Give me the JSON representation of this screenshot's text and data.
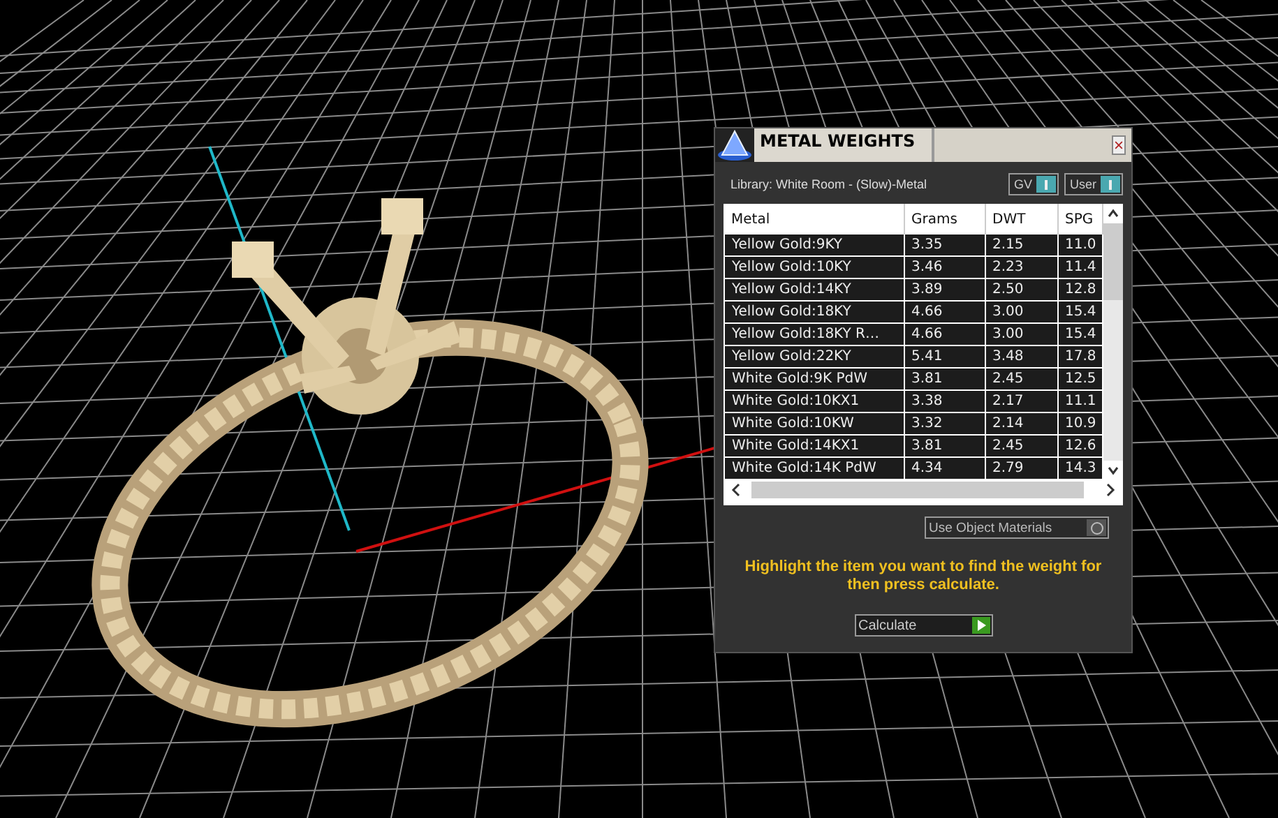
{
  "dialog": {
    "title": "METAL WEIGHTS",
    "library": "Library: White Room - (Slow)-Metal",
    "toggles": [
      {
        "label": "GV",
        "on": true
      },
      {
        "label": "User",
        "on": true
      }
    ],
    "table": {
      "columns": [
        "Metal",
        "Grams",
        "DWT",
        "SPG"
      ],
      "rows": [
        [
          "Yellow Gold:9KY",
          "3.35",
          "2.15",
          "11.0"
        ],
        [
          "Yellow Gold:10KY",
          "3.46",
          "2.23",
          "11.4"
        ],
        [
          "Yellow Gold:14KY",
          "3.89",
          "2.50",
          "12.8"
        ],
        [
          "Yellow Gold:18KY",
          "4.66",
          "3.00",
          "15.4"
        ],
        [
          "Yellow Gold:18KY R…",
          "4.66",
          "3.00",
          "15.4"
        ],
        [
          "Yellow Gold:22KY",
          "5.41",
          "3.48",
          "17.8"
        ],
        [
          "White Gold:9K PdW",
          "3.81",
          "2.45",
          "12.5"
        ],
        [
          "White Gold:10KX1",
          "3.38",
          "2.17",
          "11.1"
        ],
        [
          "White Gold:10KW",
          "3.32",
          "2.14",
          "10.9"
        ],
        [
          "White Gold:14KX1",
          "3.81",
          "2.45",
          "12.6"
        ],
        [
          "White Gold:14K PdW",
          "4.34",
          "2.79",
          "14.3"
        ]
      ]
    },
    "use_object_materials": {
      "label": "Use Object Materials",
      "checked": false
    },
    "hint": "Highlight the item you want to find the weight for then press calculate.",
    "calculate_button": "Calculate"
  }
}
